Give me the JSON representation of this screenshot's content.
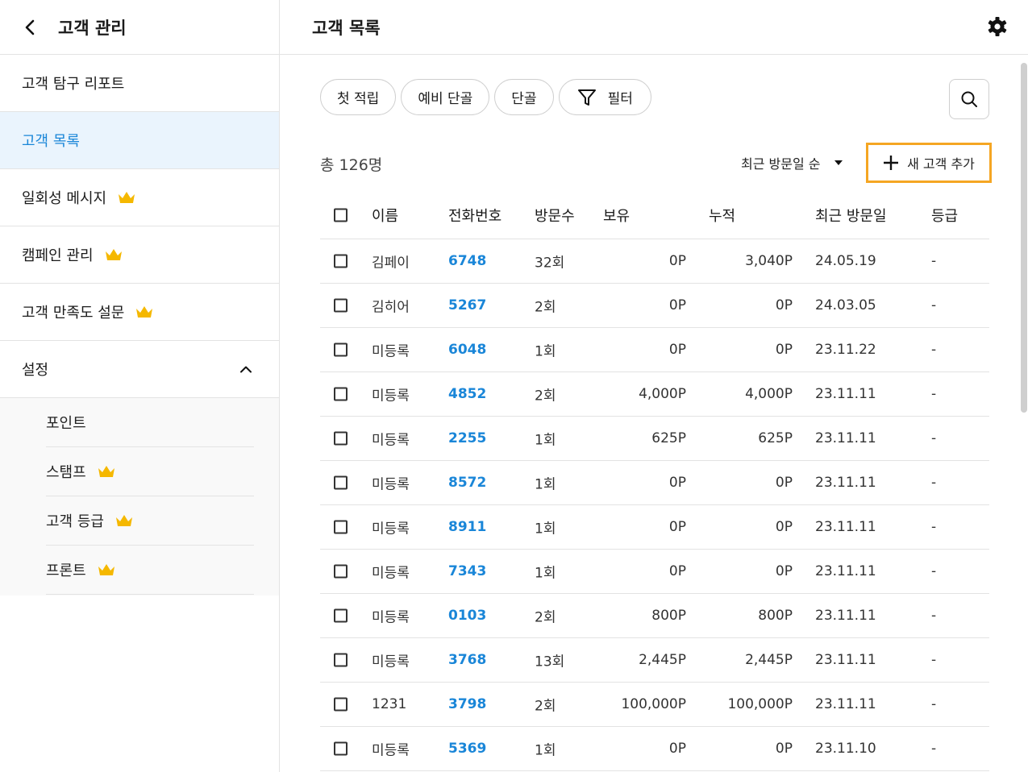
{
  "sidebar": {
    "title": "고객 관리",
    "items": [
      {
        "label": "고객 탐구 리포트",
        "active": false,
        "premium": false
      },
      {
        "label": "고객 목록",
        "active": true,
        "premium": false
      },
      {
        "label": "일회성 메시지",
        "active": false,
        "premium": true
      },
      {
        "label": "캠페인 관리",
        "active": false,
        "premium": true
      },
      {
        "label": "고객 만족도 설문",
        "active": false,
        "premium": true
      },
      {
        "label": "설정",
        "active": false,
        "premium": false
      }
    ],
    "settings_sub": [
      {
        "label": "포인트",
        "premium": false
      },
      {
        "label": "스탬프",
        "premium": true
      },
      {
        "label": "고객 등급",
        "premium": true
      },
      {
        "label": "프론트",
        "premium": true
      }
    ]
  },
  "main": {
    "title": "고객 목록",
    "chips": [
      "첫 적립",
      "예비 단골",
      "단골"
    ],
    "filter_label": "필터",
    "total": "총 126명",
    "sort_label": "최근 방문일 순",
    "add_label": "새 고객 추가"
  },
  "table": {
    "headers": {
      "name": "이름",
      "phone": "전화번호",
      "visits": "방문수",
      "hold": "보유",
      "accum": "누적",
      "date": "최근 방문일",
      "grade": "등급"
    },
    "rows": [
      {
        "name": "김페이",
        "phone": "6748",
        "visits": "32회",
        "hold": "0P",
        "accum": "3,040P",
        "date": "24.05.19",
        "grade": "-"
      },
      {
        "name": "김히어",
        "phone": "5267",
        "visits": "2회",
        "hold": "0P",
        "accum": "0P",
        "date": "24.03.05",
        "grade": "-"
      },
      {
        "name": "미등록",
        "phone": "6048",
        "visits": "1회",
        "hold": "0P",
        "accum": "0P",
        "date": "23.11.22",
        "grade": "-"
      },
      {
        "name": "미등록",
        "phone": "4852",
        "visits": "2회",
        "hold": "4,000P",
        "accum": "4,000P",
        "date": "23.11.11",
        "grade": "-"
      },
      {
        "name": "미등록",
        "phone": "2255",
        "visits": "1회",
        "hold": "625P",
        "accum": "625P",
        "date": "23.11.11",
        "grade": "-"
      },
      {
        "name": "미등록",
        "phone": "8572",
        "visits": "1회",
        "hold": "0P",
        "accum": "0P",
        "date": "23.11.11",
        "grade": "-"
      },
      {
        "name": "미등록",
        "phone": "8911",
        "visits": "1회",
        "hold": "0P",
        "accum": "0P",
        "date": "23.11.11",
        "grade": "-"
      },
      {
        "name": "미등록",
        "phone": "7343",
        "visits": "1회",
        "hold": "0P",
        "accum": "0P",
        "date": "23.11.11",
        "grade": "-"
      },
      {
        "name": "미등록",
        "phone": "0103",
        "visits": "2회",
        "hold": "800P",
        "accum": "800P",
        "date": "23.11.11",
        "grade": "-"
      },
      {
        "name": "미등록",
        "phone": "3768",
        "visits": "13회",
        "hold": "2,445P",
        "accum": "2,445P",
        "date": "23.11.11",
        "grade": "-"
      },
      {
        "name": "1231",
        "phone": "3798",
        "visits": "2회",
        "hold": "100,000P",
        "accum": "100,000P",
        "date": "23.11.11",
        "grade": "-"
      },
      {
        "name": "미등록",
        "phone": "5369",
        "visits": "1회",
        "hold": "0P",
        "accum": "0P",
        "date": "23.11.10",
        "grade": "-"
      }
    ]
  },
  "colors": {
    "accent": "#1a86d8",
    "active_bg": "#eaf4fd",
    "crown": "#f5b800",
    "highlight_border": "#f5a623"
  },
  "icons": [
    "back-icon",
    "gear-icon",
    "crown-icon",
    "chevron-up-icon",
    "filter-icon",
    "search-icon",
    "caret-down-icon",
    "plus-icon"
  ]
}
